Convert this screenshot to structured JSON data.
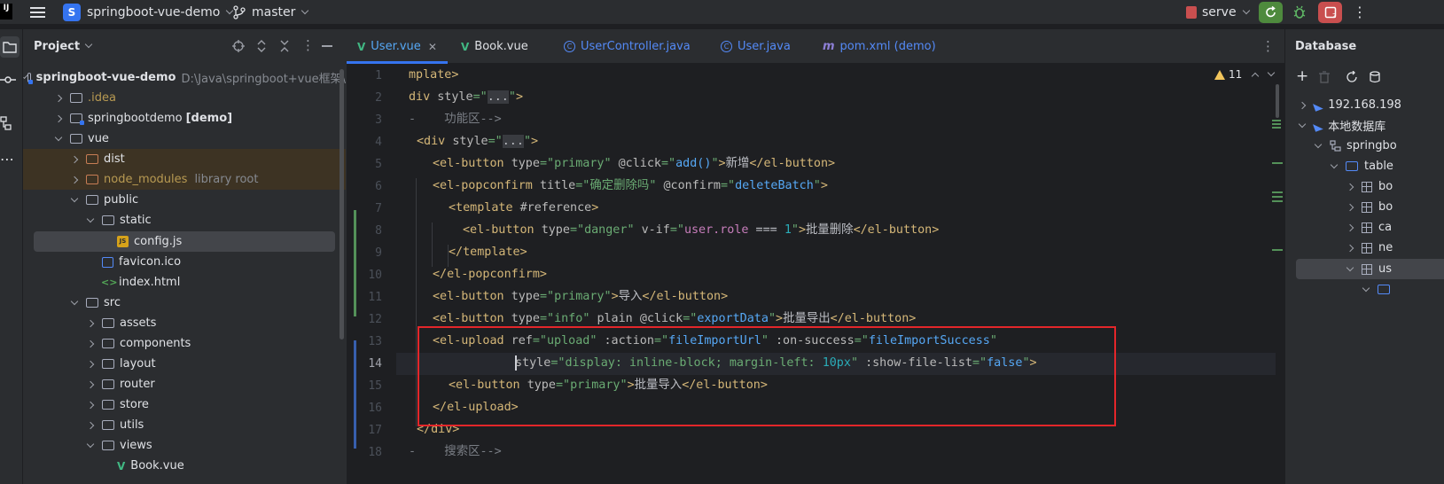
{
  "titlebar": {
    "logo_text": "IJ",
    "project_initial": "S",
    "project_name": "springboot-vue-demo",
    "branch": "master",
    "run_config": "serve"
  },
  "project_panel": {
    "title": "Project",
    "tree": [
      {
        "label": "springboot-vue-demo",
        "path": "D:\\Java\\springboot+vue框架\\",
        "kind": "module-folder",
        "expanded": true,
        "level": 0
      },
      {
        "label": ".idea",
        "kind": "folder",
        "expanded": false,
        "level": 1
      },
      {
        "label": "springbootdemo",
        "tag": "[demo]",
        "kind": "module-folder",
        "expanded": false,
        "level": 1
      },
      {
        "label": "vue",
        "kind": "folder",
        "expanded": true,
        "level": 1
      },
      {
        "label": "dist",
        "kind": "folder-orange",
        "expanded": false,
        "level": 2
      },
      {
        "label": "node_modules",
        "tag": "library root",
        "kind": "folder-orange",
        "expanded": false,
        "level": 2
      },
      {
        "label": "public",
        "kind": "folder",
        "expanded": true,
        "level": 2
      },
      {
        "label": "static",
        "kind": "folder",
        "expanded": true,
        "level": 3
      },
      {
        "label": "config.js",
        "kind": "js",
        "level": 4
      },
      {
        "label": "favicon.ico",
        "kind": "image",
        "level": 3
      },
      {
        "label": "index.html",
        "kind": "html",
        "level": 3
      },
      {
        "label": "src",
        "kind": "folder",
        "expanded": true,
        "level": 2
      },
      {
        "label": "assets",
        "kind": "folder",
        "expanded": false,
        "level": 3
      },
      {
        "label": "components",
        "kind": "folder",
        "expanded": false,
        "level": 3
      },
      {
        "label": "layout",
        "kind": "folder",
        "expanded": false,
        "level": 3
      },
      {
        "label": "router",
        "kind": "folder",
        "expanded": false,
        "level": 3
      },
      {
        "label": "store",
        "kind": "folder",
        "expanded": false,
        "level": 3
      },
      {
        "label": "utils",
        "kind": "folder",
        "expanded": false,
        "level": 3
      },
      {
        "label": "views",
        "kind": "folder",
        "expanded": true,
        "level": 3
      },
      {
        "label": "Book.vue",
        "kind": "vue",
        "level": 4
      }
    ]
  },
  "editor": {
    "tabs": [
      {
        "label": "User.vue",
        "icon": "vue-icon",
        "active": true
      },
      {
        "label": "Book.vue",
        "icon": "vue-icon",
        "active": false
      },
      {
        "label": "UserController.java",
        "icon": "class-icon",
        "active": false
      },
      {
        "label": "User.java",
        "icon": "class-icon",
        "active": false
      },
      {
        "label": "pom.xml (demo)",
        "icon": "maven-icon",
        "active": false
      }
    ],
    "warnings_count": "11",
    "line_numbers": [
      "1",
      "2",
      "3",
      "4",
      "5",
      "6",
      "7",
      "8",
      "9",
      "10",
      "11",
      "12",
      "13",
      "14",
      "15",
      "16",
      "17",
      "18"
    ],
    "current_line": "14",
    "code": {
      "l1": "mplate>",
      "l2_tag": "div",
      "l2_attr": "style",
      "l2_fold": "...",
      "l3_com": "-    功能区-->",
      "l4_tag": "<div",
      "l4_attr": "style",
      "l4_fold": "...",
      "l5_tag": "<el-button",
      "l5_a1": "type",
      "l5_v1": "primary",
      "l5_a2": "@click",
      "l5_v2": "add()",
      "l5_text": "新增",
      "l5_close": "</el-button>",
      "l6_tag": "<el-popconfirm",
      "l6_a1": "title",
      "l6_v1": "确定删除吗",
      "l6_a2": "@confirm",
      "l6_v2": "deleteBatch",
      "l7_tag": "<template",
      "l7_attr": "#reference",
      "l8_tag": "<el-button",
      "l8_a1": "type",
      "l8_v1": "danger",
      "l8_a2": "v-if",
      "l8_v2a": "user.role",
      "l8_v2b": " === ",
      "l8_v2c": "1",
      "l8_text": "批量删除",
      "l8_close": "</el-button>",
      "l9": "</template>",
      "l10": "</el-popconfirm>",
      "l11_tag": "<el-button",
      "l11_a1": "type",
      "l11_v1": "primary",
      "l11_text": "导入",
      "l11_close": "</el-button>",
      "l12_tag": "<el-button",
      "l12_a1": "type",
      "l12_v1": "info",
      "l12_a2": "plain",
      "l12_a3": "@click",
      "l12_v3": "exportData",
      "l12_text": "批量导出",
      "l12_close": "</el-button>",
      "l13_tag": "<el-upload",
      "l13_a1": "ref",
      "l13_v1": "upload",
      "l13_a2": ":action",
      "l13_v2": "fileImportUrl",
      "l13_a3": ":on-success",
      "l13_v3": "fileImportSuccess",
      "l14_a1": "style",
      "l14_v1a": "display: ",
      "l14_v1b": "inline-block",
      "l14_v1c": "; margin-left: ",
      "l14_v1d": "10px",
      "l14_a2": ":show-file-list",
      "l14_v2": "false",
      "l15_tag": "<el-button",
      "l15_a1": "type",
      "l15_v1": "primary",
      "l15_text": "批量导入",
      "l15_close": "</el-button>",
      "l16": "</el-upload>",
      "l17": "</div>",
      "l18_com": "-    搜索区-->"
    }
  },
  "database_panel": {
    "title": "Database",
    "tree": [
      {
        "label": "192.168.198",
        "kind": "datasource",
        "level": 0
      },
      {
        "label": "本地数据库",
        "kind": "datasource",
        "level": 0
      },
      {
        "label": "springbo",
        "kind": "schema",
        "level": 1
      },
      {
        "label": "table",
        "kind": "folder",
        "level": 2
      },
      {
        "label": "bo",
        "kind": "table",
        "level": 3
      },
      {
        "label": "bo",
        "kind": "table",
        "level": 3
      },
      {
        "label": "ca",
        "kind": "table",
        "level": 3
      },
      {
        "label": "ne",
        "kind": "table",
        "level": 3
      },
      {
        "label": "us",
        "kind": "table",
        "level": 3
      }
    ]
  },
  "colors": {
    "accent": "#3574f0",
    "highlight_box": "#e3262a",
    "background": "#1e1f22",
    "panel": "#2b2d30"
  }
}
